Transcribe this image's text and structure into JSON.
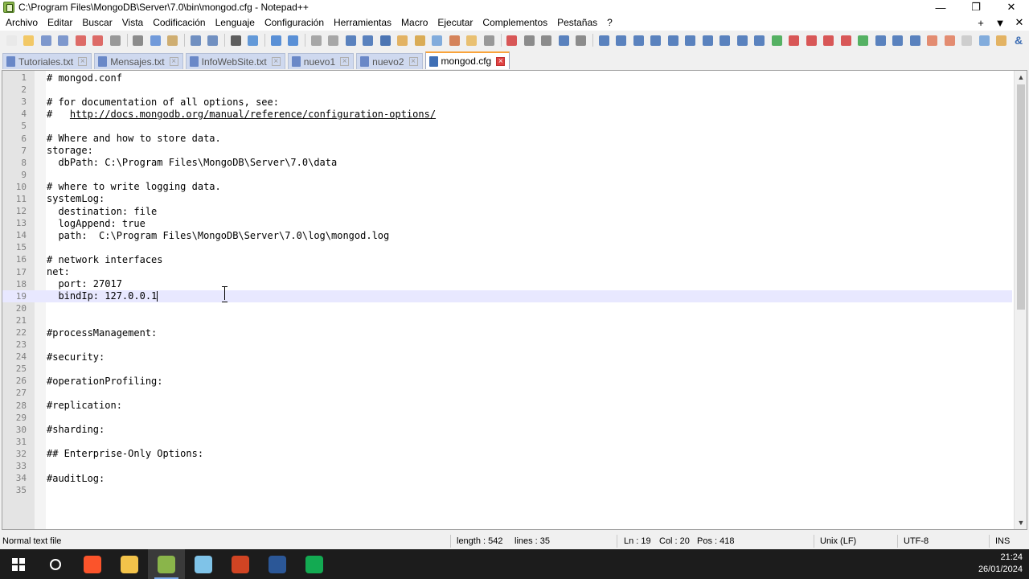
{
  "window": {
    "title": "C:\\Program Files\\MongoDB\\Server\\7.0\\bin\\mongod.cfg - Notepad++",
    "minimize": "—",
    "restore": "❐",
    "close": "✕"
  },
  "menu": {
    "items": [
      "Archivo",
      "Editar",
      "Buscar",
      "Vista",
      "Codificación",
      "Lenguaje",
      "Configuración",
      "Herramientas",
      "Macro",
      "Ejecutar",
      "Complementos",
      "Pestañas",
      "?"
    ],
    "right": [
      "+",
      "▼",
      "✕"
    ]
  },
  "toolbar": {
    "icons": [
      {
        "name": "new-file-icon",
        "color": "#e8e8e8"
      },
      {
        "name": "open-file-icon",
        "color": "#f2c14e"
      },
      {
        "name": "save-icon",
        "color": "#6a88c7"
      },
      {
        "name": "save-all-icon",
        "color": "#6a88c7"
      },
      {
        "name": "close-icon",
        "color": "#d9534f"
      },
      {
        "name": "close-all-icon",
        "color": "#d9534f"
      },
      {
        "name": "print-icon",
        "color": "#888888"
      },
      {
        "sep": true
      },
      {
        "name": "cut-icon",
        "color": "#7a7a7a"
      },
      {
        "name": "copy-icon",
        "color": "#5b8bd6"
      },
      {
        "name": "paste-icon",
        "color": "#c9a25a"
      },
      {
        "sep": true
      },
      {
        "name": "undo-icon",
        "color": "#5a7fb8"
      },
      {
        "name": "redo-icon",
        "color": "#5a7fb8"
      },
      {
        "sep": true
      },
      {
        "name": "find-icon",
        "color": "#444444"
      },
      {
        "name": "replace-icon",
        "color": "#4a8ad4"
      },
      {
        "sep": true
      },
      {
        "name": "zoom-in-icon",
        "color": "#3f7fd1"
      },
      {
        "name": "zoom-out-icon",
        "color": "#3f7fd1"
      },
      {
        "sep": true
      },
      {
        "name": "sync-vertical-icon",
        "color": "#9a9a9a"
      },
      {
        "name": "sync-horizontal-icon",
        "color": "#9a9a9a"
      },
      {
        "name": "word-wrap-icon",
        "color": "#3f6fb5"
      },
      {
        "name": "show-all-chars-icon",
        "color": "#3f6fb5"
      },
      {
        "name": "indent-guide-icon",
        "color": "#2f5fa8"
      },
      {
        "name": "udl-icon",
        "color": "#e0a84a"
      },
      {
        "name": "doc-map-icon",
        "color": "#d6a03a"
      },
      {
        "name": "doc-list-icon",
        "color": "#6fa0d8"
      },
      {
        "name": "function-list-icon",
        "color": "#d07040"
      },
      {
        "name": "folder-workspace-icon",
        "color": "#e7b75a"
      },
      {
        "name": "monitoring-icon",
        "color": "#8a8a8a"
      },
      {
        "sep": true
      },
      {
        "name": "record-macro-icon",
        "color": "#d43c3c"
      },
      {
        "name": "stop-macro-icon",
        "color": "#7a7a7a"
      },
      {
        "name": "play-macro-icon",
        "color": "#7a7a7a"
      },
      {
        "name": "run-macro-multiple-icon",
        "color": "#3f6fb5"
      },
      {
        "name": "save-macro-icon",
        "color": "#7a7a7a"
      },
      {
        "sep": true
      },
      {
        "name": "compare-icon",
        "color": "#3f6fb5"
      },
      {
        "name": "compare-options-icon",
        "color": "#3f6fb5"
      },
      {
        "name": "compare-lines-icon",
        "color": "#3f6fb5"
      },
      {
        "name": "clear-compare-icon",
        "color": "#3f6fb5"
      },
      {
        "name": "first-diff-icon",
        "color": "#3f6fb5"
      },
      {
        "name": "prev-diff-icon",
        "color": "#3f6fb5"
      },
      {
        "name": "next-diff-icon",
        "color": "#3f6fb5"
      },
      {
        "name": "last-diff-icon",
        "color": "#3f6fb5"
      },
      {
        "name": "diff-view-icon",
        "color": "#3f6fb5"
      },
      {
        "name": "sync-scroll-icon",
        "color": "#3f6fb5"
      },
      {
        "name": "checkmark-icon",
        "color": "#3aa64a"
      },
      {
        "name": "first-bookmark-icon",
        "color": "#d43c3c"
      },
      {
        "name": "prev-bookmark-icon",
        "color": "#d43c3c"
      },
      {
        "name": "next-bookmark-icon",
        "color": "#d43c3c"
      },
      {
        "name": "last-bookmark-icon",
        "color": "#d43c3c"
      },
      {
        "name": "plugin-a-icon",
        "color": "#3aa64a"
      },
      {
        "name": "plugin-b-icon",
        "color": "#3f6fb5"
      },
      {
        "name": "plugin-c-icon",
        "color": "#3f6fb5"
      },
      {
        "name": "plugin-d-icon",
        "color": "#3f6fb5"
      },
      {
        "name": "plugin-e-icon",
        "color": "#e07a5a"
      },
      {
        "name": "plugin-f-icon",
        "color": "#e07a5a"
      },
      {
        "name": "plugin-g-icon",
        "color": "#c8c8c8"
      },
      {
        "name": "plugin-h-icon",
        "color": "#6fa0d8"
      },
      {
        "name": "plugin-i-icon",
        "color": "#e0a84a"
      },
      {
        "name": "ampersand-icon",
        "color": "#3f6fb5",
        "glyph": "&"
      }
    ]
  },
  "tabs": [
    {
      "label": "Tutoriales.txt",
      "color": "#6a88c7",
      "active": false
    },
    {
      "label": "Mensajes.txt",
      "color": "#6a88c7",
      "active": false
    },
    {
      "label": "InfoWebSite.txt",
      "color": "#6a88c7",
      "active": false
    },
    {
      "label": "nuevo1",
      "color": "#6a88c7",
      "active": false
    },
    {
      "label": "nuevo2",
      "color": "#6a88c7",
      "active": false
    },
    {
      "label": "mongod.cfg",
      "color": "#3f6fb5",
      "active": true
    }
  ],
  "editor": {
    "current_line": 19,
    "lines": [
      "# mongod.conf",
      "",
      "# for documentation of all options, see:",
      "#   http://docs.mongodb.org/manual/reference/configuration-options/",
      "",
      "# Where and how to store data.",
      "storage:",
      "  dbPath: C:\\Program Files\\MongoDB\\Server\\7.0\\data",
      "",
      "# where to write logging data.",
      "systemLog:",
      "  destination: file",
      "  logAppend: true",
      "  path:  C:\\Program Files\\MongoDB\\Server\\7.0\\log\\mongod.log",
      "",
      "# network interfaces",
      "net:",
      "  port: 27017",
      "  bindIp: 127.0.0.1",
      "",
      "",
      "#processManagement:",
      "",
      "#security:",
      "",
      "#operationProfiling:",
      "",
      "#replication:",
      "",
      "#sharding:",
      "",
      "## Enterprise-Only Options:",
      "",
      "#auditLog:",
      ""
    ],
    "url": "http://docs.mongodb.org/manual/reference/configuration-options/"
  },
  "status": {
    "file_type": "Normal text file",
    "length": "length : 542",
    "lines": "lines : 35",
    "ln": "Ln : 19",
    "col": "Col : 20",
    "pos": "Pos : 418",
    "eol": "Unix (LF)",
    "encoding": "UTF-8",
    "mode": "INS"
  },
  "taskbar": {
    "apps": [
      {
        "name": "windows-start-icon",
        "color": "#ffffff",
        "active": false
      },
      {
        "name": "search-icon",
        "color": "#ffffff",
        "active": false
      },
      {
        "name": "brave-browser-icon",
        "color": "#fb542b",
        "active": false
      },
      {
        "name": "file-explorer-icon",
        "color": "#f3c34a",
        "active": false
      },
      {
        "name": "notepadpp-icon",
        "color": "#8ab54a",
        "active": true
      },
      {
        "name": "notepad-icon",
        "color": "#7fc3e8",
        "active": false
      },
      {
        "name": "powerpoint-icon",
        "color": "#d04423",
        "active": false
      },
      {
        "name": "word-icon",
        "color": "#2b5797",
        "active": false
      },
      {
        "name": "mongodb-compass-icon",
        "color": "#13aa52",
        "active": false
      }
    ],
    "time": "21:24",
    "date": "26/01/2024"
  }
}
